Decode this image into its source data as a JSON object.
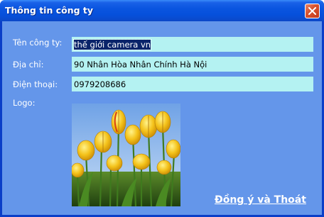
{
  "window": {
    "title": "Thông tin công ty",
    "close_icon": "close-icon"
  },
  "form": {
    "company_label": "Tên công ty:",
    "company_value": "thế giới camera vn",
    "address_label": "Địa chỉ:",
    "address_value": "90 Nhân Hòa Nhân Chính Hà Nội",
    "phone_label": "Điện thoại:",
    "phone_value": "0979208686",
    "logo_label": "Logo:"
  },
  "actions": {
    "confirm_label": "Đồng ý và Thoát"
  },
  "colors": {
    "titlebar": "#0a55e0",
    "client_bg": "#6496ea",
    "field_bg": "#b4f2f2",
    "close_btn": "#d8542f"
  }
}
